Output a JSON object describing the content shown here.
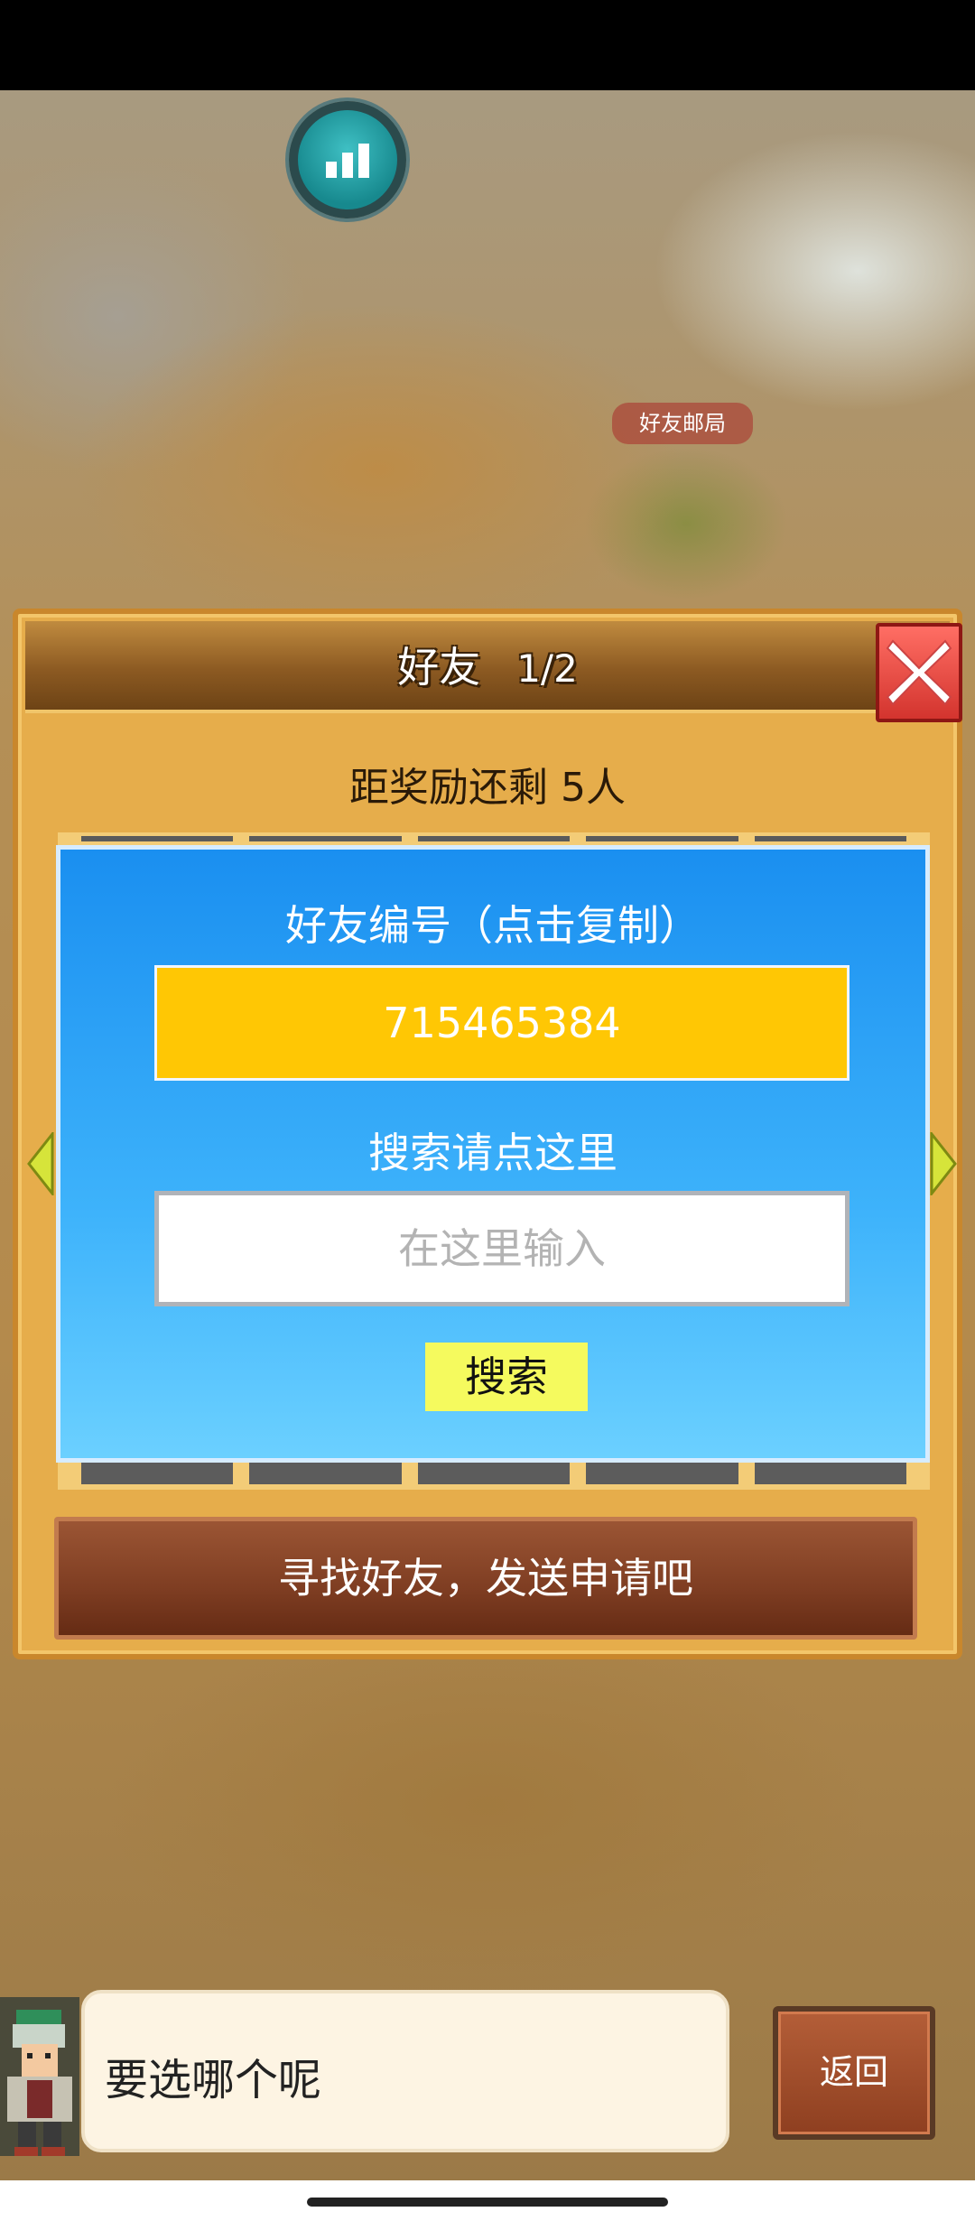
{
  "map": {
    "label": "好友邮局"
  },
  "dialog": {
    "title": "好友",
    "page": "1/2",
    "reward_text": "距奖励还剩 5人",
    "id_label": "好友编号（点击复制）",
    "friend_id": "715465384",
    "search_label": "搜索请点这里",
    "search_placeholder": "在这里输入",
    "search_button": "搜索",
    "find_button": "寻找好友，发送申请吧"
  },
  "bottom": {
    "speech": "要选哪个呢",
    "back_button": "返回"
  },
  "icons": {
    "stats": "bar-chart-icon",
    "close": "close-icon",
    "left": "arrow-left-icon",
    "right": "arrow-right-icon"
  },
  "colors": {
    "id_box": "#ffc704",
    "panel_blue": "#1a8ff0",
    "close_red": "#e9473f",
    "search_button": "#f5fa5e"
  }
}
